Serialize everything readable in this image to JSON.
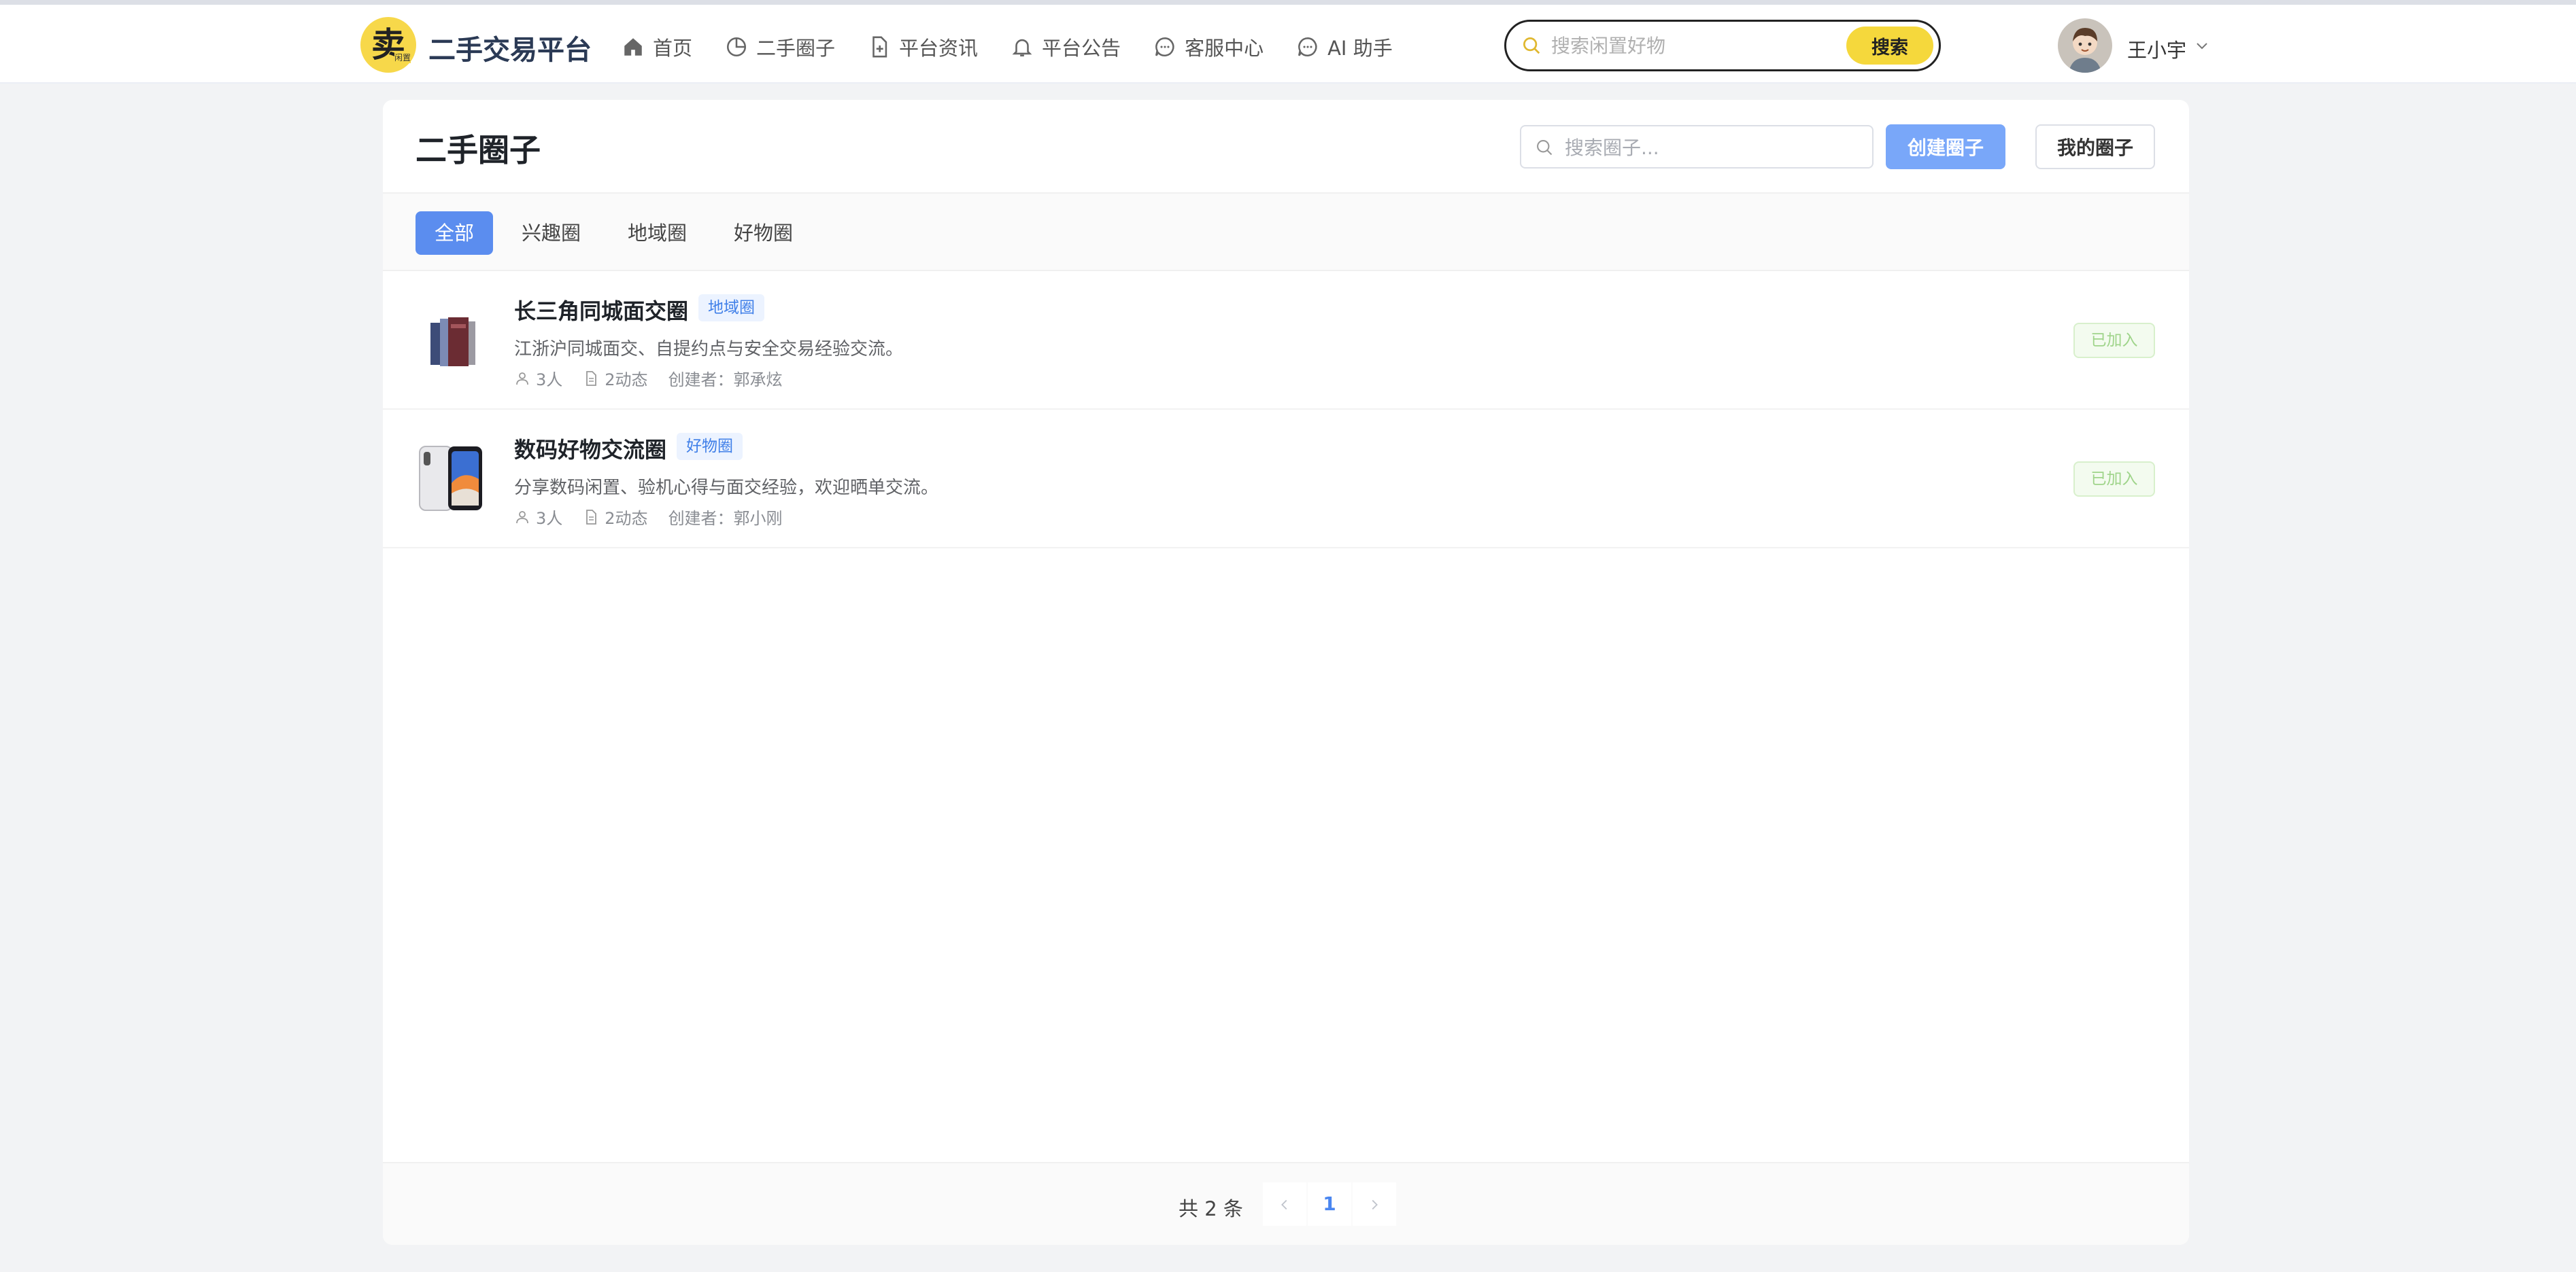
{
  "header": {
    "logo_glyph": "卖",
    "logo_mini": "闲置",
    "brand": "二手交易平台",
    "nav": [
      {
        "label": "首页",
        "icon": "home-icon"
      },
      {
        "label": "二手圈子",
        "icon": "pie-chart-icon"
      },
      {
        "label": "平台资讯",
        "icon": "document-icon"
      },
      {
        "label": "平台公告",
        "icon": "bell-icon"
      },
      {
        "label": "客服中心",
        "icon": "chat-icon"
      },
      {
        "label": "AI 助手",
        "icon": "chat-icon"
      }
    ],
    "search": {
      "placeholder": "搜索闲置好物",
      "value": "",
      "button": "搜索"
    },
    "user": {
      "name": "王小宇",
      "avatar": "avatar-icon"
    }
  },
  "page": {
    "title": "二手圈子",
    "circle_search_placeholder": "搜索圈子...",
    "create_button": "创建圈子",
    "mine_button": "我的圈子"
  },
  "tabs": [
    "全部",
    "兴趣圈",
    "地域圈",
    "好物圈"
  ],
  "active_tab": 0,
  "circles": [
    {
      "name": "长三角同城面交圈",
      "tag": "地域圈",
      "description": "江浙沪同城面交、自提约点与安全交易经验交流。",
      "members": "3人",
      "posts": "2动态",
      "creator": "创建者：郭承炫",
      "status": "已加入",
      "thumb": "books-image"
    },
    {
      "name": "数码好物交流圈",
      "tag": "好物圈",
      "description": "分享数码闲置、验机心得与面交经验，欢迎晒单交流。",
      "members": "3人",
      "posts": "2动态",
      "creator": "创建者：郭小刚",
      "status": "已加入",
      "thumb": "phone-image"
    }
  ],
  "pagination": {
    "total": "共 2 条",
    "current": "1"
  },
  "colors": {
    "accent": "#5b8def",
    "brand_yellow": "#f5d83c",
    "joined": "#9fd48a",
    "tag": "#3f7fe8"
  }
}
